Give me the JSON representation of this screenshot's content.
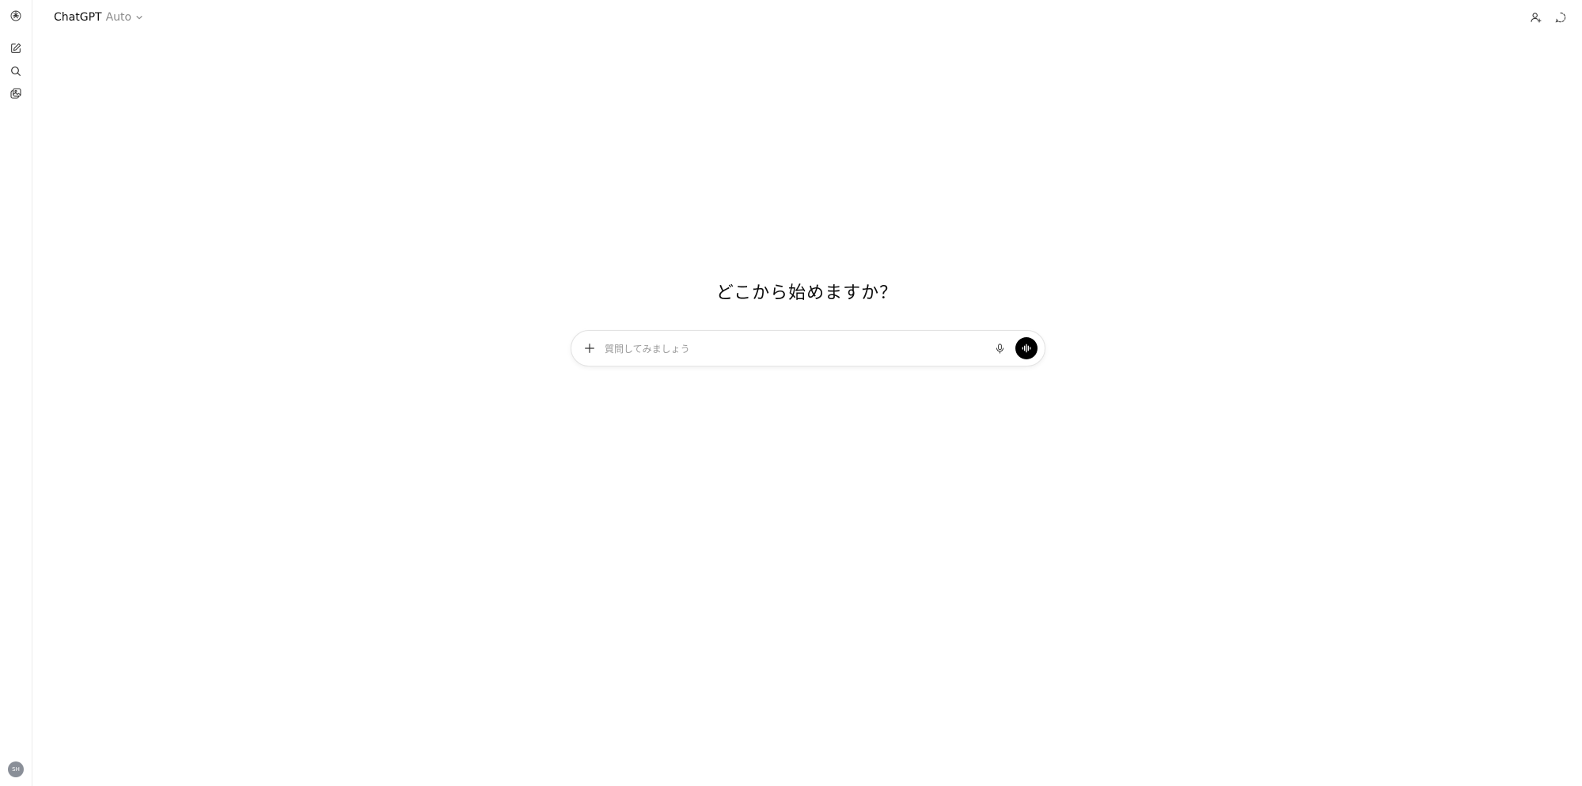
{
  "header": {
    "model_name": "ChatGPT",
    "model_variant": "Auto"
  },
  "sidebar": {
    "avatar_initials": "SH"
  },
  "main": {
    "headline": "どこから始めますか？"
  },
  "composer": {
    "placeholder": "質問してみましょう",
    "value": ""
  },
  "icons": {
    "logo": "openai-logo-icon",
    "new_chat": "new-chat-icon",
    "search": "search-icon",
    "library": "image-library-icon",
    "share": "add-person-icon",
    "temporary": "temporary-chat-icon",
    "attach": "plus-icon",
    "dictate": "microphone-icon",
    "voice": "voice-mode-icon"
  },
  "colors": {
    "background": "#ffffff",
    "text": "#0d0d0d",
    "muted": "#8f8f8f",
    "voice_button": "#000000"
  }
}
